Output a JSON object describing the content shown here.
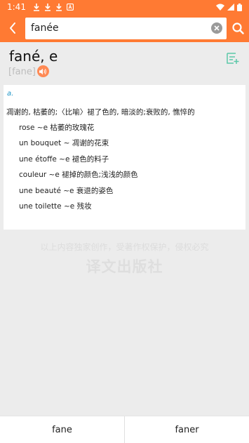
{
  "status_bar": {
    "time": "1:41"
  },
  "search": {
    "value": "fanée"
  },
  "entry": {
    "headword": "fané, e",
    "phonetic": "[fane]",
    "pos": "a.",
    "definition": "凋谢的, 枯萎的;〈比喻〉褪了色的, 暗淡的;衰败的, 憔悴的",
    "examples": [
      "rose ~e 枯萎的玫瑰花",
      "un bouquet ~ 凋谢的花束",
      "une étoffe ~e 褪色的料子",
      "couleur ~e 褪掉的颜色;浅浅的颜色",
      "une beauté ~e 衰退的姿色",
      "une toilette ~e 残妆"
    ]
  },
  "watermark": {
    "line1": "以上内容独家创作，受著作权保护，侵权必究",
    "line2": "译文出版社"
  },
  "bottom_nav": {
    "prev": "fane",
    "next": "faner"
  },
  "colors": {
    "accent": "#ff7a33",
    "pos": "#2196c7",
    "addword_icon": "#5bc8a8"
  }
}
